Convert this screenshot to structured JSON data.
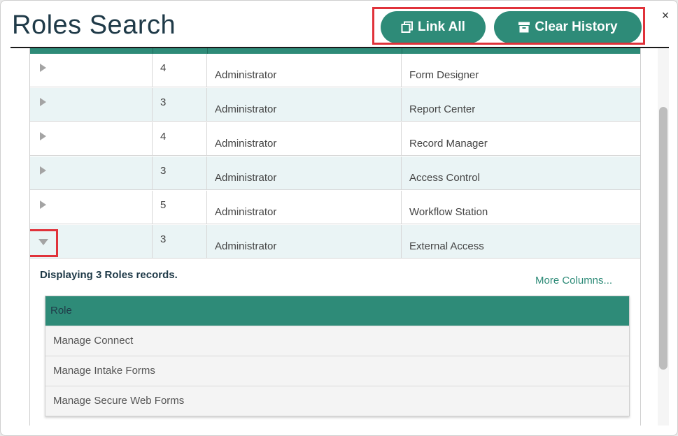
{
  "dialog": {
    "title": "Roles Search",
    "close_glyph": "×"
  },
  "toolbar": {
    "link_all_label": "Link All",
    "clear_history_label": "Clear History",
    "link_icon": "link-window-icon",
    "clear_icon": "archive-box-icon"
  },
  "rows": [
    {
      "count": "4",
      "type": "Administrator",
      "name": "Form Designer",
      "expanded": false
    },
    {
      "count": "3",
      "type": "Administrator",
      "name": "Report Center",
      "expanded": false
    },
    {
      "count": "4",
      "type": "Administrator",
      "name": "Record Manager",
      "expanded": false
    },
    {
      "count": "3",
      "type": "Administrator",
      "name": "Access Control",
      "expanded": false
    },
    {
      "count": "5",
      "type": "Administrator",
      "name": "Workflow Station",
      "expanded": false
    },
    {
      "count": "3",
      "type": "Administrator",
      "name": "External Access",
      "expanded": true
    }
  ],
  "detail": {
    "displaying_text": "Displaying 3 Roles records.",
    "more_columns_label": "More Columns...",
    "sub_table": {
      "header": "Role",
      "rows": [
        "Manage Connect",
        "Manage Intake Forms",
        "Manage Secure Web Forms"
      ]
    }
  },
  "colors": {
    "accent": "#2e8b78",
    "highlight": "#e0323a",
    "title_text": "#1f3a48"
  }
}
